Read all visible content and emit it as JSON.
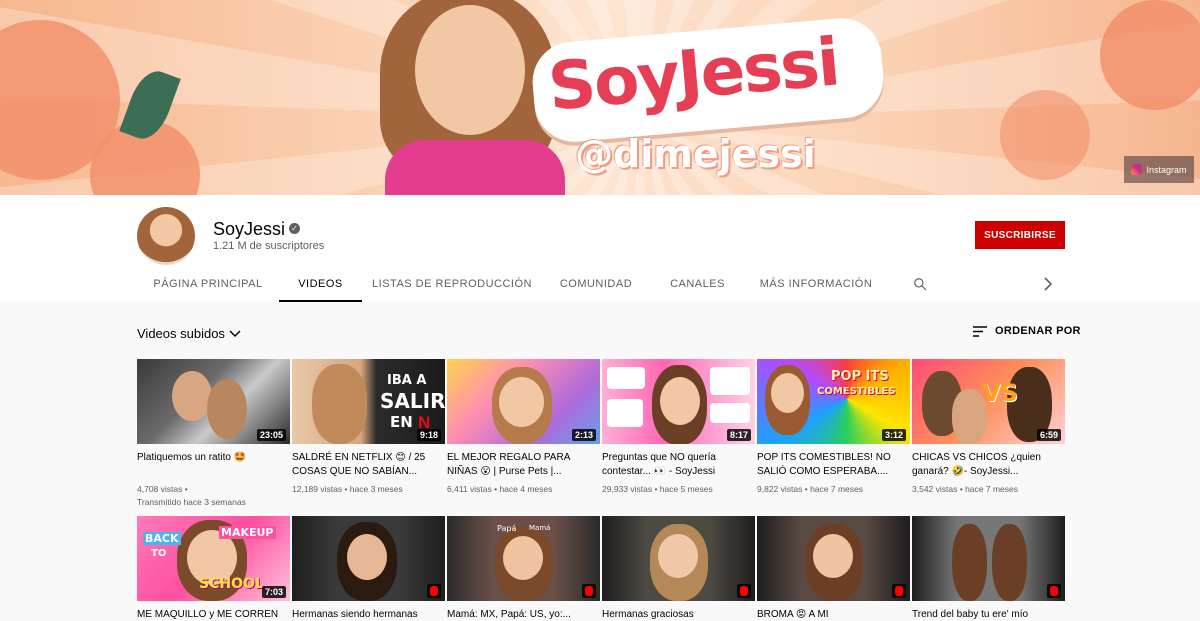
{
  "banner": {
    "logo_text": "SoyJessi",
    "handle": "@dimejessi",
    "instagram_label": "Instagram"
  },
  "channel": {
    "name": "SoyJessi",
    "subscribers": "1.21 M de suscriptores",
    "subscribe_label": "SUSCRIBIRSE"
  },
  "tabs": [
    {
      "label": "PÁGINA PRINCIPAL"
    },
    {
      "label": "VIDEOS"
    },
    {
      "label": "LISTAS DE REPRODUCCIÓN"
    },
    {
      "label": "COMUNIDAD"
    },
    {
      "label": "CANALES"
    },
    {
      "label": "MÁS INFORMACIÓN"
    }
  ],
  "section": {
    "title": "Videos subidos",
    "sort_label": "ORDENAR POR"
  },
  "videos": [
    {
      "title": "Platiquemos un ratito 🤩",
      "views": "4,708 vistas",
      "age": "Transmitido hace 3 semanas",
      "duration": "23:05"
    },
    {
      "title": "SALDRÉ EN NETFLIX 😊 / 25 COSAS QUE NO SABÍAN...",
      "views": "12,189 vistas",
      "age": "hace 3 meses",
      "duration": "9:18"
    },
    {
      "title": "EL MEJOR REGALO PARA NIÑAS 😮 | Purse Pets |...",
      "views": "6,411 vistas",
      "age": "hace 4 meses",
      "duration": "2:13"
    },
    {
      "title": "Preguntas que NO quería contestar... 👀 - SoyJessi",
      "views": "29,933 vistas",
      "age": "hace 5 meses",
      "duration": "8:17"
    },
    {
      "title": "POP ITS COMESTIBLES! NO SALIÓ COMO ESPERABA....",
      "views": "9,822 vistas",
      "age": "hace 7 meses",
      "duration": "3:12"
    },
    {
      "title": "CHICAS VS CHICOS ¿quien ganará? 🤣- SoyJessi...",
      "views": "3,542 vistas",
      "age": "hace 7 meses",
      "duration": "6:59"
    },
    {
      "title": "ME MAQUILLO y ME CORREN",
      "duration": "7:03"
    },
    {
      "title": "Hermanas siendo hermanas"
    },
    {
      "title": "Mamá: MX, Papá: US, yo:..."
    },
    {
      "title": "Hermanas graciosas"
    },
    {
      "title": "BROMA 😡 A MI"
    },
    {
      "title": "Trend del baby tu ere' mío"
    }
  ],
  "thumb_text": {
    "v2": [
      "IBA A",
      "SALIR",
      "EN"
    ],
    "v5": [
      "POP ITS",
      "COMESTIBLES"
    ],
    "v6": "VS",
    "v7": [
      "BACK",
      "TO",
      "SCHOOL",
      "MAKEUP"
    ],
    "v9": [
      "Papá",
      "Mamá"
    ]
  },
  "colors": {
    "subscribe": "#cc0000",
    "text_primary": "#030303",
    "text_secondary": "#606060"
  }
}
